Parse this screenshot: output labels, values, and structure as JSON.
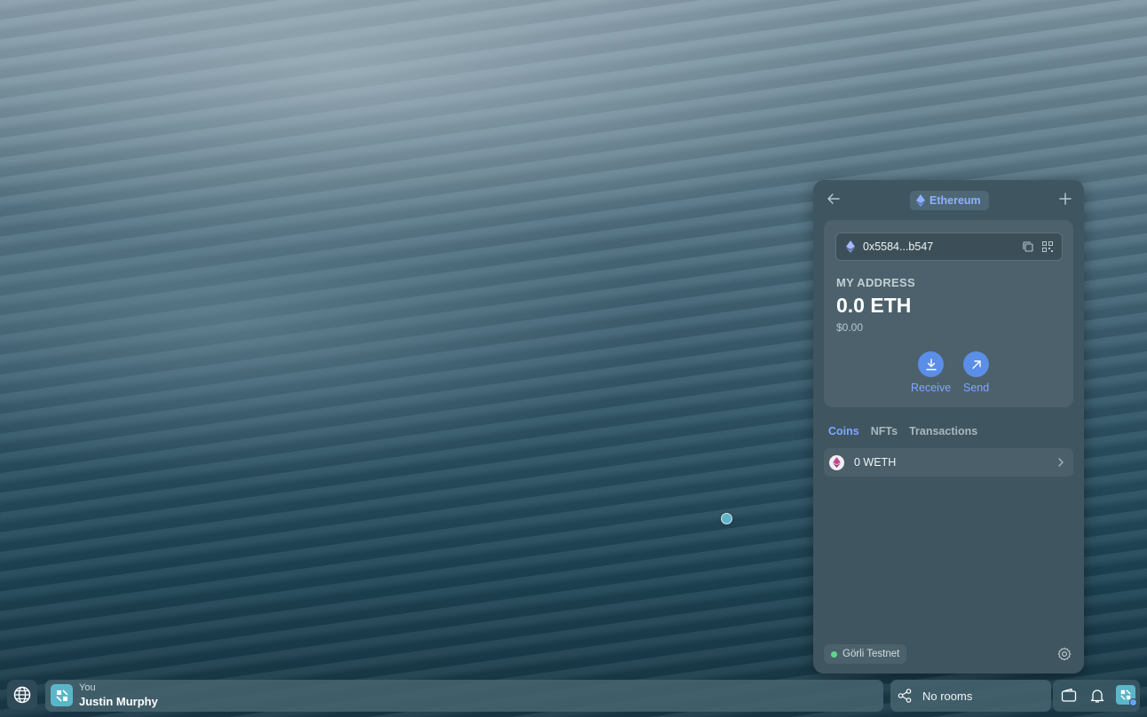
{
  "wallet": {
    "network": "Ethereum",
    "address": "0x5584...b547",
    "address_label": "MY ADDRESS",
    "balance": "0.0 ETH",
    "fiat": "$0.00",
    "receive_label": "Receive",
    "send_label": "Send",
    "tabs": [
      {
        "label": "Coins",
        "active": true
      },
      {
        "label": "NFTs",
        "active": false
      },
      {
        "label": "Transactions",
        "active": false
      }
    ],
    "coins": [
      {
        "label": "0 WETH",
        "icon": "ethereum-icon"
      }
    ],
    "testnet": "Görli Testnet",
    "accent_color": "#7fa7ff",
    "panel_color": "#3f5560"
  },
  "taskbar": {
    "user_caption": "You",
    "user_name": "Justin Murphy",
    "rooms_label": "No rooms"
  }
}
